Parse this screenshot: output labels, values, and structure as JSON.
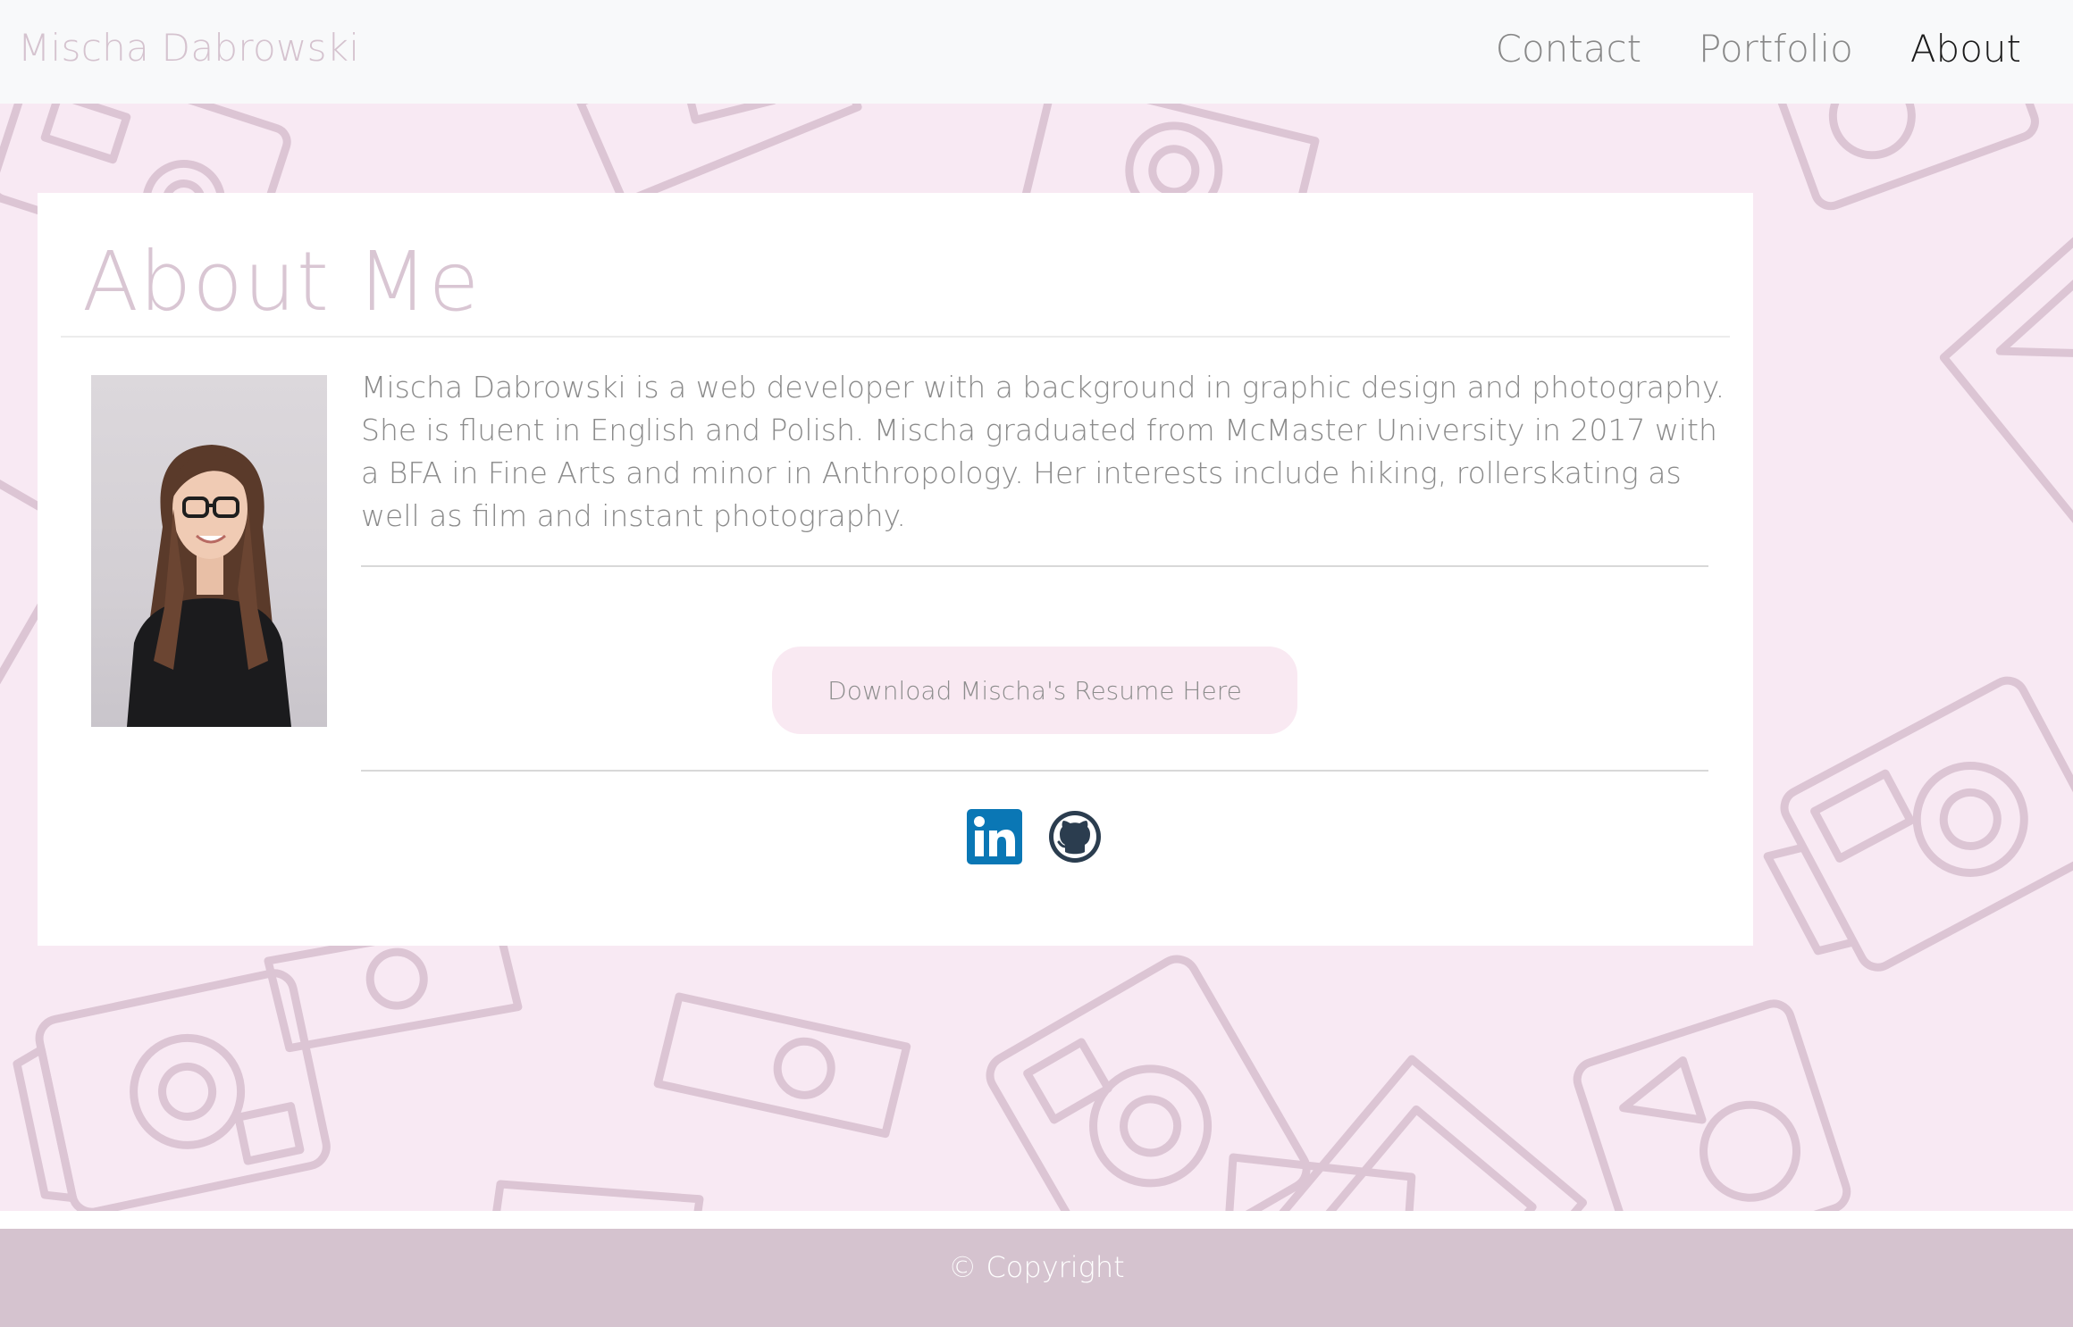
{
  "navbar": {
    "brand": "Mischa Dabrowski",
    "links": [
      {
        "label": "Contact"
      },
      {
        "label": "Portfolio"
      },
      {
        "label": "About",
        "active": true
      }
    ]
  },
  "about": {
    "title": "About Me",
    "bio": "Mischa Dabrowski is a web developer with a background in graphic design and photography. She is fluent in English and Polish. Mischa graduated from McMaster University in 2017 with a BFA in Fine Arts and minor in Anthropology. Her interests include hiking, rollerskating as well as film and instant photography.",
    "resume_button": "Download Mischa's Resume Here",
    "social_icons": [
      "linkedin-icon",
      "github-icon"
    ]
  },
  "footer": {
    "copyright": "© Copyright"
  },
  "colors": {
    "navbar_bg": "#f8f9fa",
    "brand": "#d5c3cf",
    "page_bg": "#f8e9f3",
    "pattern": "#dcc5d4",
    "footer_bg": "#d5c3cf",
    "linkedin": "#0a77b5",
    "github": "#2b3d4f"
  }
}
